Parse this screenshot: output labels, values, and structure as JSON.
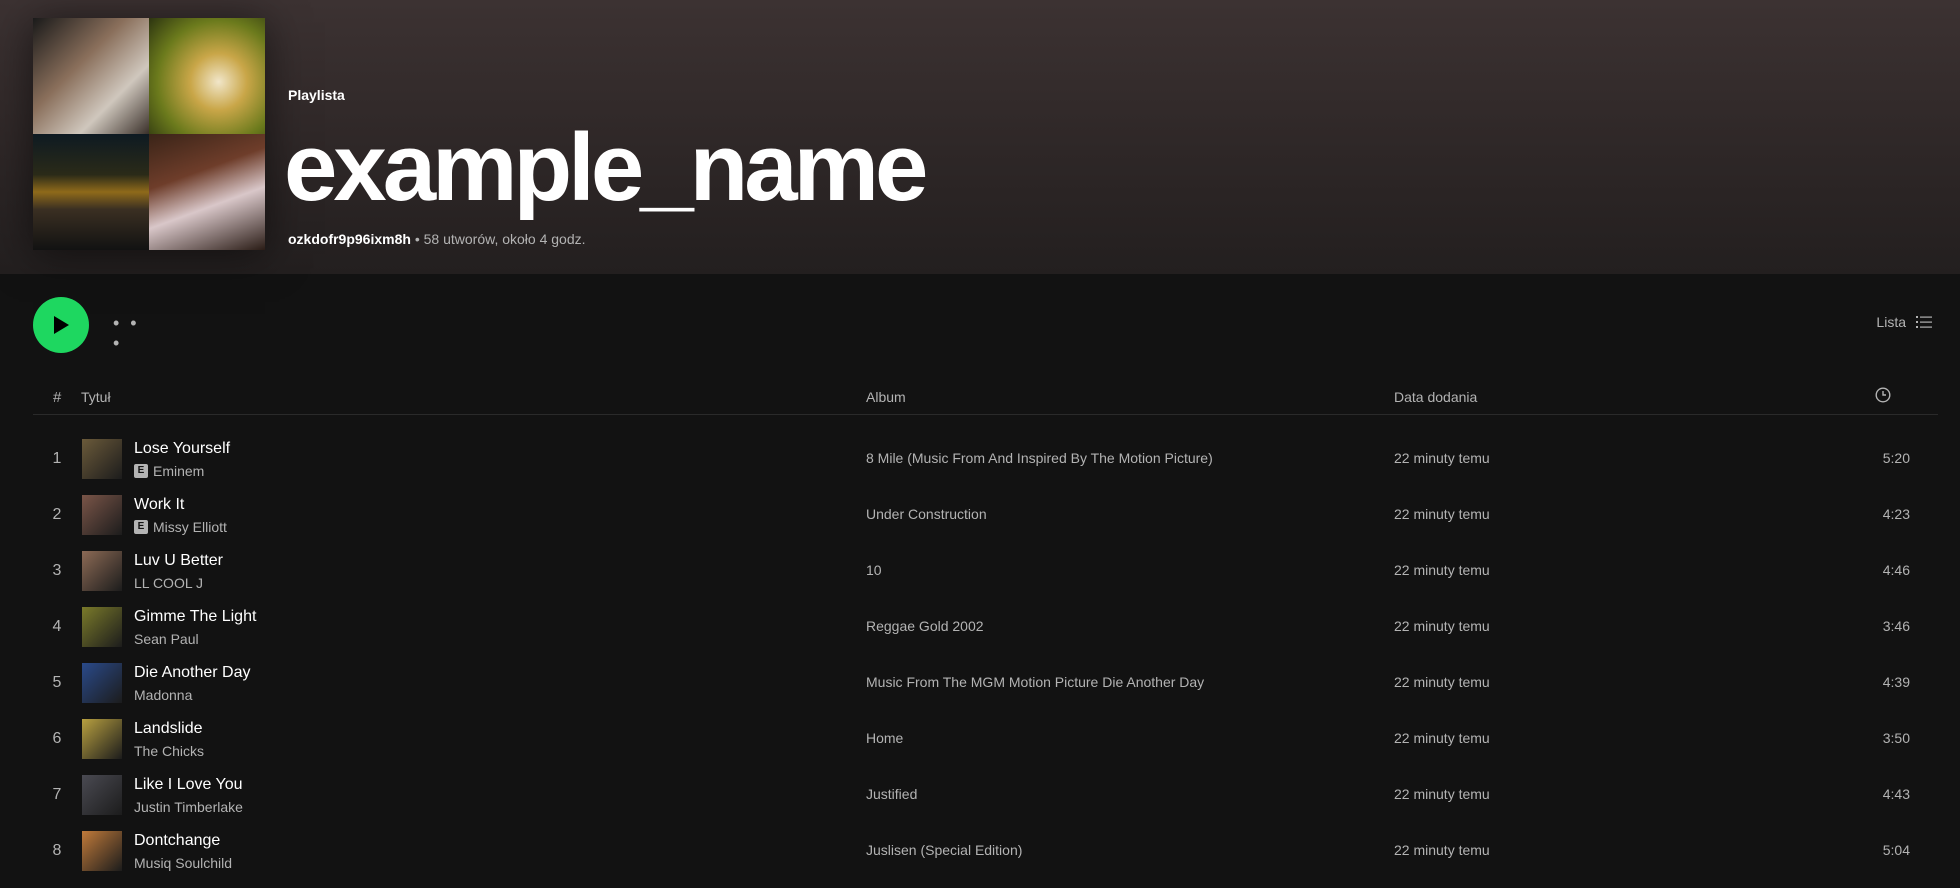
{
  "playlist": {
    "type_label": "Playlista",
    "title": "example_name",
    "owner": "ozkdofr9p96ixm8h",
    "meta": " • 58 utworów, około 4 godz."
  },
  "toolbar": {
    "more_label": "• • •",
    "view_label": "Lista"
  },
  "columns": {
    "num": "#",
    "title": "Tytuł",
    "album": "Album",
    "date": "Data dodania"
  },
  "tracks": [
    {
      "num": "1",
      "title": "Lose Yourself",
      "artist": "Eminem",
      "explicit": "E",
      "album": "8 Mile (Music From And Inspired By The Motion Picture)",
      "date": "22 minuty temu",
      "duration": "5:20",
      "color": "#6b5a3a"
    },
    {
      "num": "2",
      "title": "Work It",
      "artist": "Missy Elliott",
      "explicit": "E",
      "album": "Under Construction",
      "date": "22 minuty temu",
      "duration": "4:23",
      "color": "#7a5548"
    },
    {
      "num": "3",
      "title": "Luv U Better",
      "artist": "LL COOL J",
      "explicit": null,
      "album": "10",
      "date": "22 minuty temu",
      "duration": "4:46",
      "color": "#8c6a55"
    },
    {
      "num": "4",
      "title": "Gimme The Light",
      "artist": "Sean Paul",
      "explicit": null,
      "album": "Reggae Gold 2002",
      "date": "22 minuty temu",
      "duration": "3:46",
      "color": "#7a7a2a"
    },
    {
      "num": "5",
      "title": "Die Another Day",
      "artist": "Madonna",
      "explicit": null,
      "album": "Music From The MGM Motion Picture Die Another Day",
      "date": "22 minuty temu",
      "duration": "4:39",
      "color": "#2a4a8a"
    },
    {
      "num": "6",
      "title": "Landslide",
      "artist": "The Chicks",
      "explicit": null,
      "album": "Home",
      "date": "22 minuty temu",
      "duration": "3:50",
      "color": "#b8a040"
    },
    {
      "num": "7",
      "title": "Like I Love You",
      "artist": "Justin Timberlake",
      "explicit": null,
      "album": "Justified",
      "date": "22 minuty temu",
      "duration": "4:43",
      "color": "#4a4a52"
    },
    {
      "num": "8",
      "title": "Dontchange",
      "artist": "Musiq Soulchild",
      "explicit": null,
      "album": "Juslisen (Special Edition)",
      "date": "22 minuty temu",
      "duration": "5:04",
      "color": "#c07a3a"
    }
  ],
  "icons": {
    "play": "play-icon",
    "list_view": "list-view-icon",
    "duration": "clock-icon"
  },
  "colors": {
    "accent": "#1ed760",
    "background": "#121212",
    "muted_text": "#b3b3b3"
  }
}
